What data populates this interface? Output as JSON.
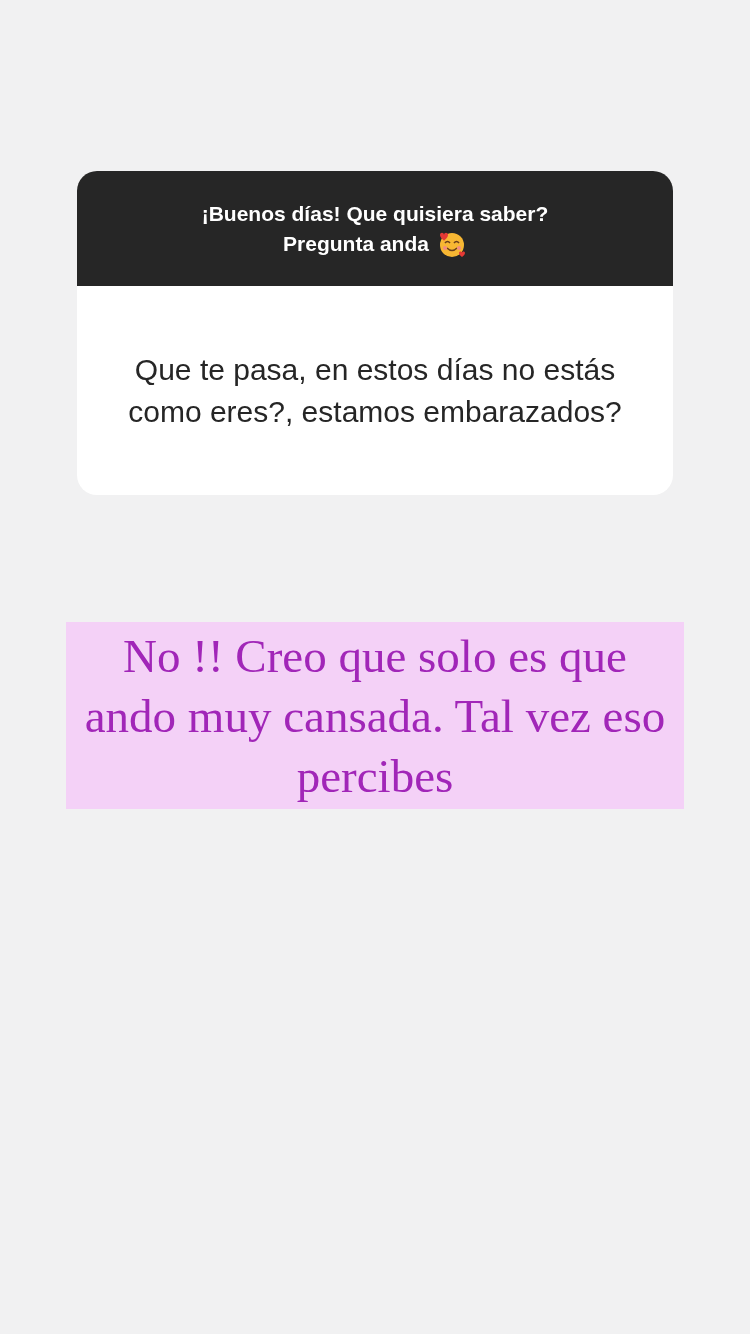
{
  "question_card": {
    "header_lines": [
      "¡Buenos días! Que quisiera saber?",
      "Pregunta anda"
    ],
    "question": "Que te pasa, en estos días no estás como eres?, estamos embarazados?"
  },
  "answer": {
    "text": "No !! Creo que solo es que ando muy cansada. Tal vez eso percibes"
  }
}
